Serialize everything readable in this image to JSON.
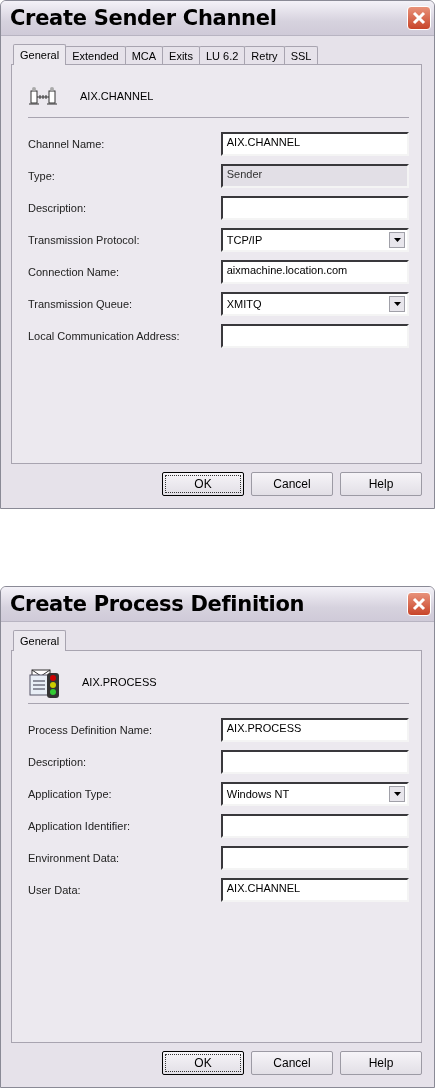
{
  "dialogs": [
    {
      "title": "Create Sender Channel",
      "kind": "channel",
      "tabs": [
        {
          "label": "General",
          "selected": true
        },
        {
          "label": "Extended",
          "selected": false
        },
        {
          "label": "MCA",
          "selected": false
        },
        {
          "label": "Exits",
          "selected": false
        },
        {
          "label": "LU 6.2",
          "selected": false
        },
        {
          "label": "Retry",
          "selected": false
        },
        {
          "label": "SSL",
          "selected": false
        }
      ],
      "header": "AIX.CHANNEL",
      "fields": [
        {
          "label": "Channel Name:",
          "kind": "text",
          "value": "AIX.CHANNEL"
        },
        {
          "label": "Type:",
          "kind": "readonly",
          "value": "Sender"
        },
        {
          "label": "Description:",
          "kind": "text"
        },
        {
          "label": "Transmission Protocol:",
          "kind": "dropdown",
          "value": "TCP/IP"
        },
        {
          "label": "Connection Name:",
          "kind": "text",
          "value": "aixmachine.location.com"
        },
        {
          "label": "Transmission Queue:",
          "kind": "dropdown",
          "value": "XMITQ"
        },
        {
          "label": "Local Communication Address:",
          "kind": "text"
        }
      ],
      "buttons": [
        {
          "label": "OK",
          "default": true
        },
        {
          "label": "Cancel",
          "default": false
        },
        {
          "label": "Help",
          "default": false
        }
      ]
    },
    {
      "title": "Create Process Definition",
      "kind": "process",
      "tabs": [
        {
          "label": "General",
          "selected": true
        }
      ],
      "header": "AIX.PROCESS",
      "fields": [
        {
          "label": "Process Definition Name:",
          "kind": "text",
          "value": "AIX.PROCESS"
        },
        {
          "label": "Description:",
          "kind": "text"
        },
        {
          "label": "Application Type:",
          "kind": "dropdown",
          "value": "Windows NT"
        },
        {
          "label": "Application Identifier:",
          "kind": "text"
        },
        {
          "label": "Environment Data:",
          "kind": "text"
        },
        {
          "label": "User Data:",
          "kind": "text",
          "value": "AIX.CHANNEL"
        }
      ],
      "buttons": [
        {
          "label": "OK",
          "default": true
        },
        {
          "label": "Cancel",
          "default": false
        },
        {
          "label": "Help",
          "default": false
        }
      ]
    }
  ]
}
